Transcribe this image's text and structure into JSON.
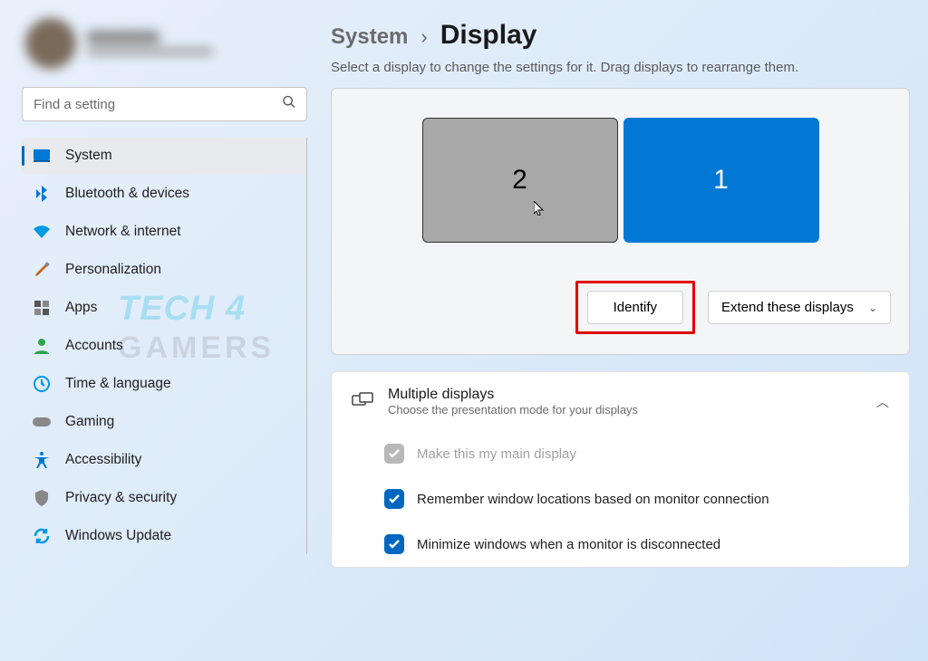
{
  "search": {
    "placeholder": "Find a setting"
  },
  "nav": {
    "items": [
      {
        "label": "System",
        "icon_color": "#0078d4"
      },
      {
        "label": "Bluetooth & devices",
        "icon_color": "#0078d4"
      },
      {
        "label": "Network & internet",
        "icon_color": "#0099e5"
      },
      {
        "label": "Personalization",
        "icon_color": "#c06a2c"
      },
      {
        "label": "Apps",
        "icon_color": "#6b6b6b"
      },
      {
        "label": "Accounts",
        "icon_color": "#2ea44f"
      },
      {
        "label": "Time & language",
        "icon_color": "#0099e5"
      },
      {
        "label": "Gaming",
        "icon_color": "#888"
      },
      {
        "label": "Accessibility",
        "icon_color": "#0078d4"
      },
      {
        "label": "Privacy & security",
        "icon_color": "#888"
      },
      {
        "label": "Windows Update",
        "icon_color": "#0099e5"
      }
    ]
  },
  "breadcrumb": {
    "parent": "System",
    "sep": "›",
    "current": "Display"
  },
  "subtitle": "Select a display to change the settings for it. Drag displays to rearrange them.",
  "monitors": {
    "secondary": "2",
    "primary": "1"
  },
  "actions": {
    "identify": "Identify",
    "mode": "Extend these displays"
  },
  "multi": {
    "title": "Multiple displays",
    "sub": "Choose the presentation mode for your displays",
    "opt1": "Make this my main display",
    "opt2": "Remember window locations based on monitor connection",
    "opt3": "Minimize windows when a monitor is disconnected"
  }
}
